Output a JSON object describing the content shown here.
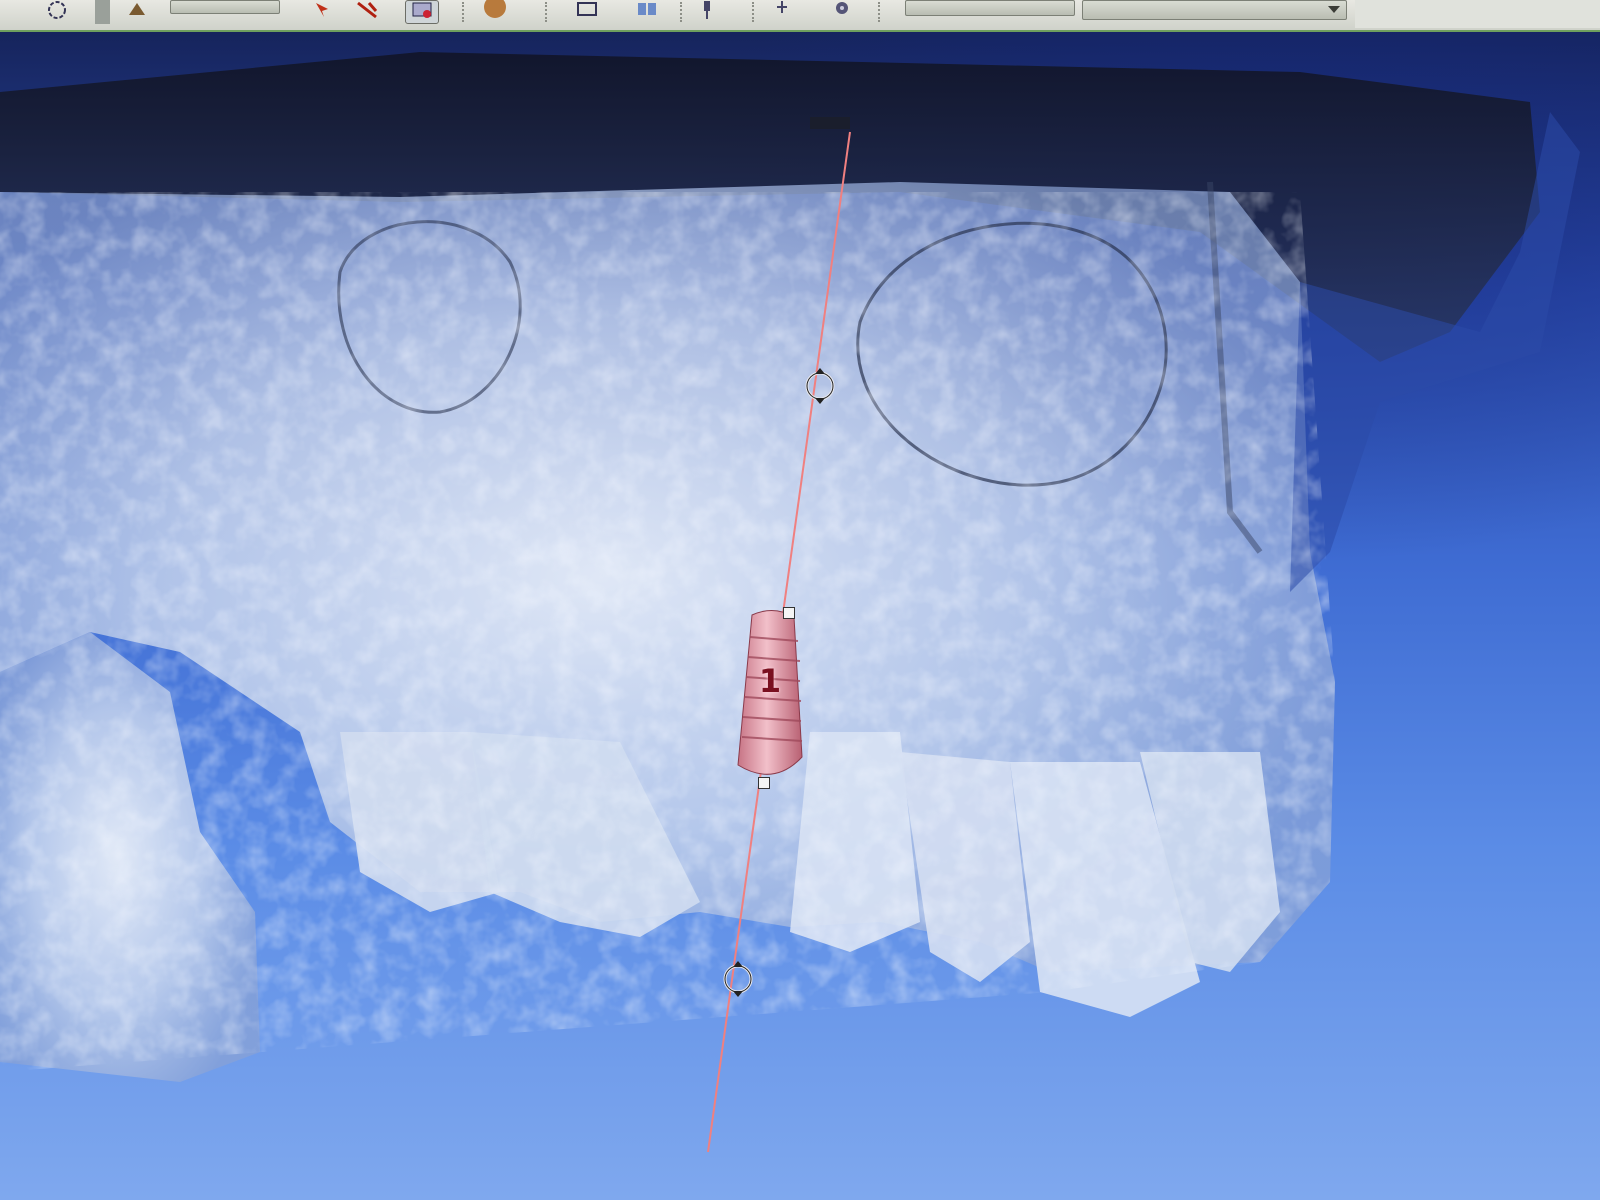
{
  "toolbar": {
    "icons": [
      "rotate-icon",
      "move-icon",
      "pointer-icon",
      "measure-icon",
      "view-icon",
      "sphere-icon",
      "layout-icon",
      "split-view-icon",
      "pin-icon",
      "tool-icon",
      "settings-icon"
    ],
    "view_field_value": "",
    "view_select_value": ""
  },
  "viewport": {
    "background_color": "#3e6bd2",
    "guide_line_color": "#f08080"
  },
  "implant": {
    "label": "1",
    "color": "#e8a0ae"
  }
}
